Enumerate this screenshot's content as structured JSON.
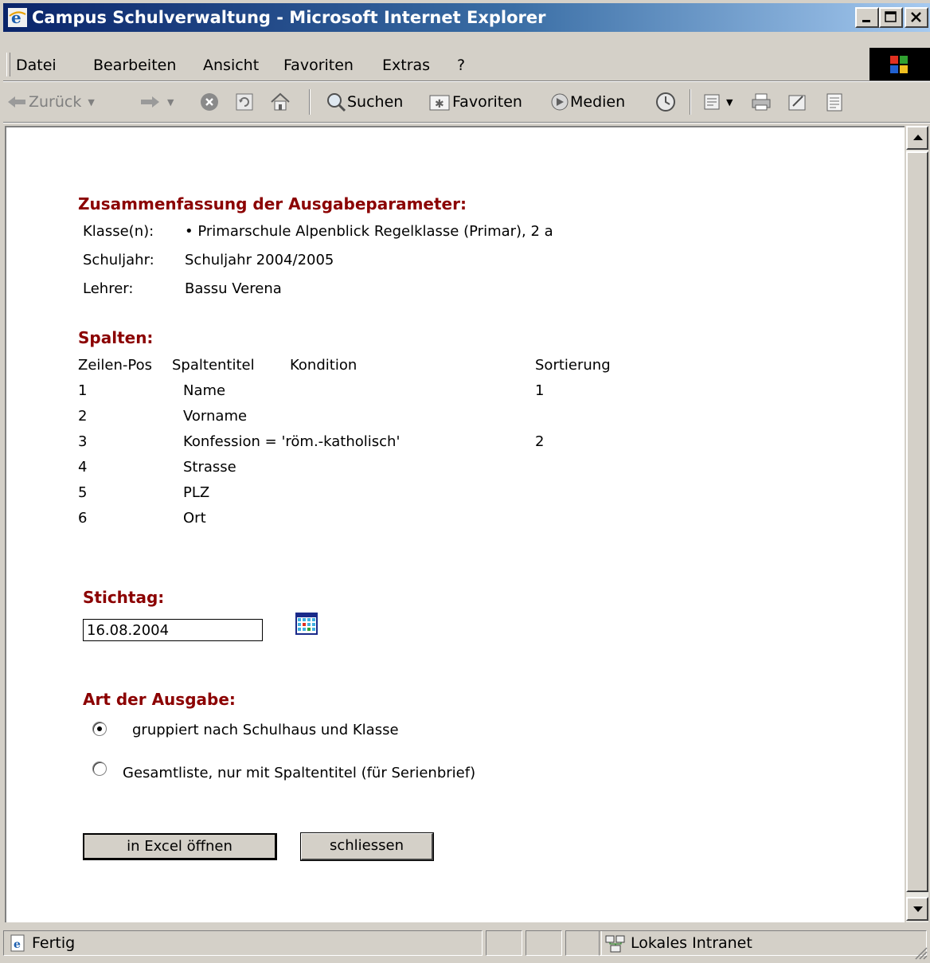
{
  "window": {
    "title": "Campus Schulverwaltung - Microsoft Internet Explorer"
  },
  "menu": {
    "items": [
      "Datei",
      "Bearbeiten",
      "Ansicht",
      "Favoriten",
      "Extras",
      "?"
    ]
  },
  "toolbar": {
    "back_label": "Zurück",
    "search_label": "Suchen",
    "favorites_label": "Favoriten",
    "media_label": "Medien"
  },
  "summary": {
    "heading": "Zusammenfassung der Ausgabeparameter:",
    "class_label": "Klasse(n):",
    "class_value": "• Primarschule Alpenblick Regelklasse (Primar), 2 a",
    "year_label": "Schuljahr:",
    "year_value": "Schuljahr 2004/2005",
    "teacher_label": "Lehrer:",
    "teacher_value": "Bassu Verena"
  },
  "columns": {
    "heading": "Spalten:",
    "headers": [
      "Zeilen-Pos",
      "Spaltentitel",
      "Kondition",
      "Sortierung"
    ],
    "rows": [
      {
        "pos": "1",
        "title": "Name",
        "sort": "1"
      },
      {
        "pos": "2",
        "title": "Vorname",
        "sort": ""
      },
      {
        "pos": "3",
        "title": "Konfession = 'röm.-katholisch'",
        "sort": "2"
      },
      {
        "pos": "4",
        "title": "Strasse",
        "sort": ""
      },
      {
        "pos": "5",
        "title": "PLZ",
        "sort": ""
      },
      {
        "pos": "6",
        "title": "Ort",
        "sort": ""
      }
    ]
  },
  "stichtag": {
    "heading": "Stichtag:",
    "value": "16.08.2004"
  },
  "output": {
    "heading": "Art der Ausgabe:",
    "option1": "gruppiert nach Schulhaus und Klasse",
    "option2": "Gesamtliste, nur mit Spaltentitel (für Serienbrief)",
    "selected": "option1"
  },
  "buttons": {
    "excel": "in Excel öffnen",
    "close": "schliessen"
  },
  "status": {
    "left": "Fertig",
    "zone": "Lokales Intranet"
  }
}
